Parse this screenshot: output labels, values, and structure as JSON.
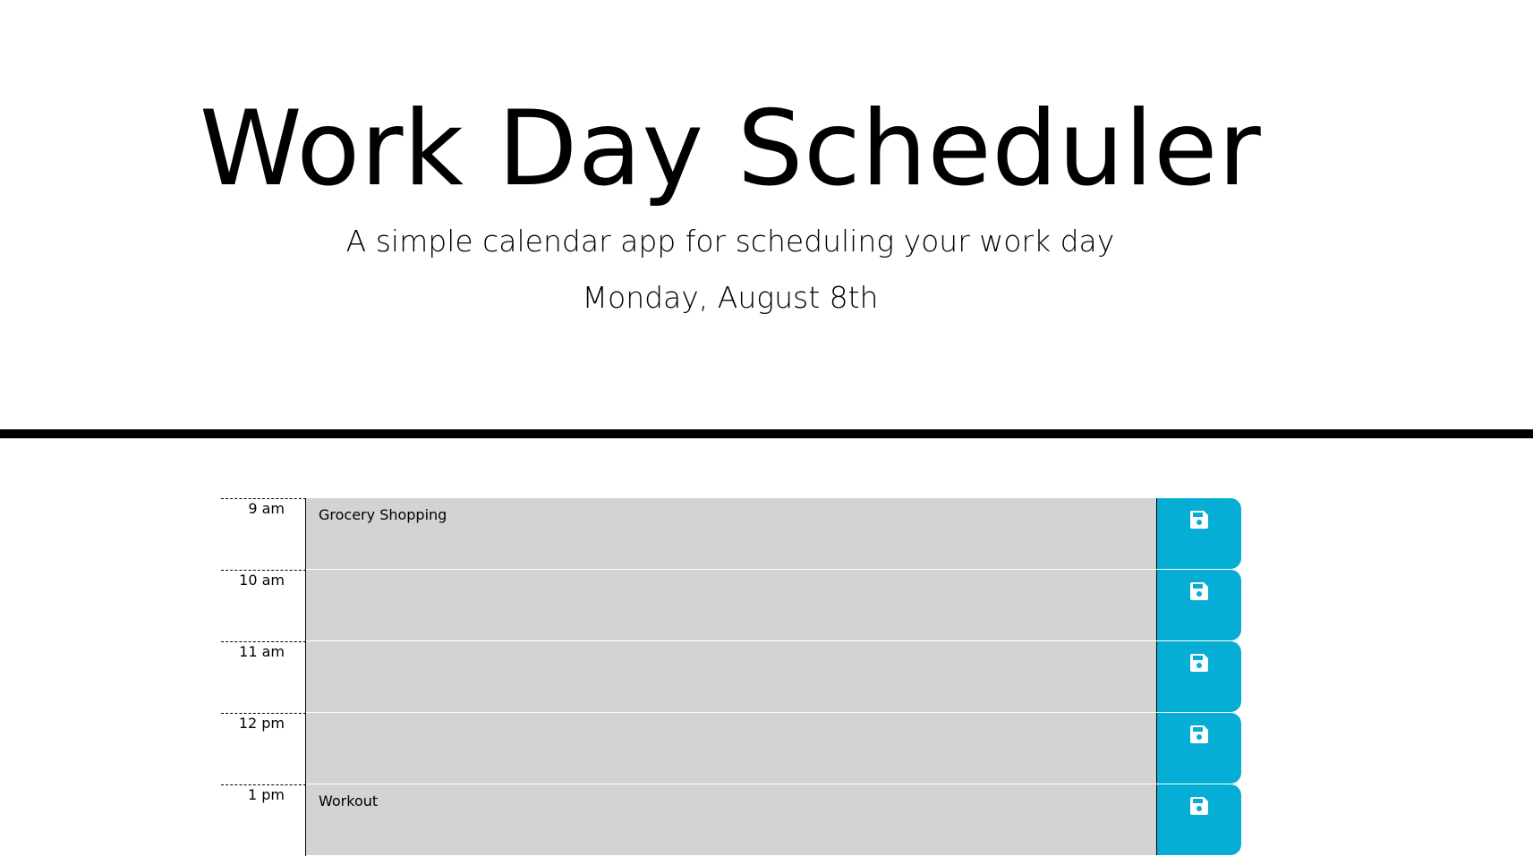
{
  "header": {
    "title": "Work Day Scheduler",
    "subtitle": "A simple calendar app for scheduling your work day",
    "current_day": "Monday, August 8th"
  },
  "time_blocks": [
    {
      "hour": "9 am",
      "text": "Grocery Shopping",
      "save_icon": "save-icon"
    },
    {
      "hour": "10 am",
      "text": "",
      "save_icon": "save-icon"
    },
    {
      "hour": "11 am",
      "text": "",
      "save_icon": "save-icon"
    },
    {
      "hour": "12 pm",
      "text": "",
      "save_icon": "save-icon"
    },
    {
      "hour": "1 pm",
      "text": "Workout",
      "save_icon": "save-icon"
    }
  ],
  "colors": {
    "past_block": "#d3d3d3",
    "save_button": "#06aed5",
    "divider": "#000000"
  }
}
